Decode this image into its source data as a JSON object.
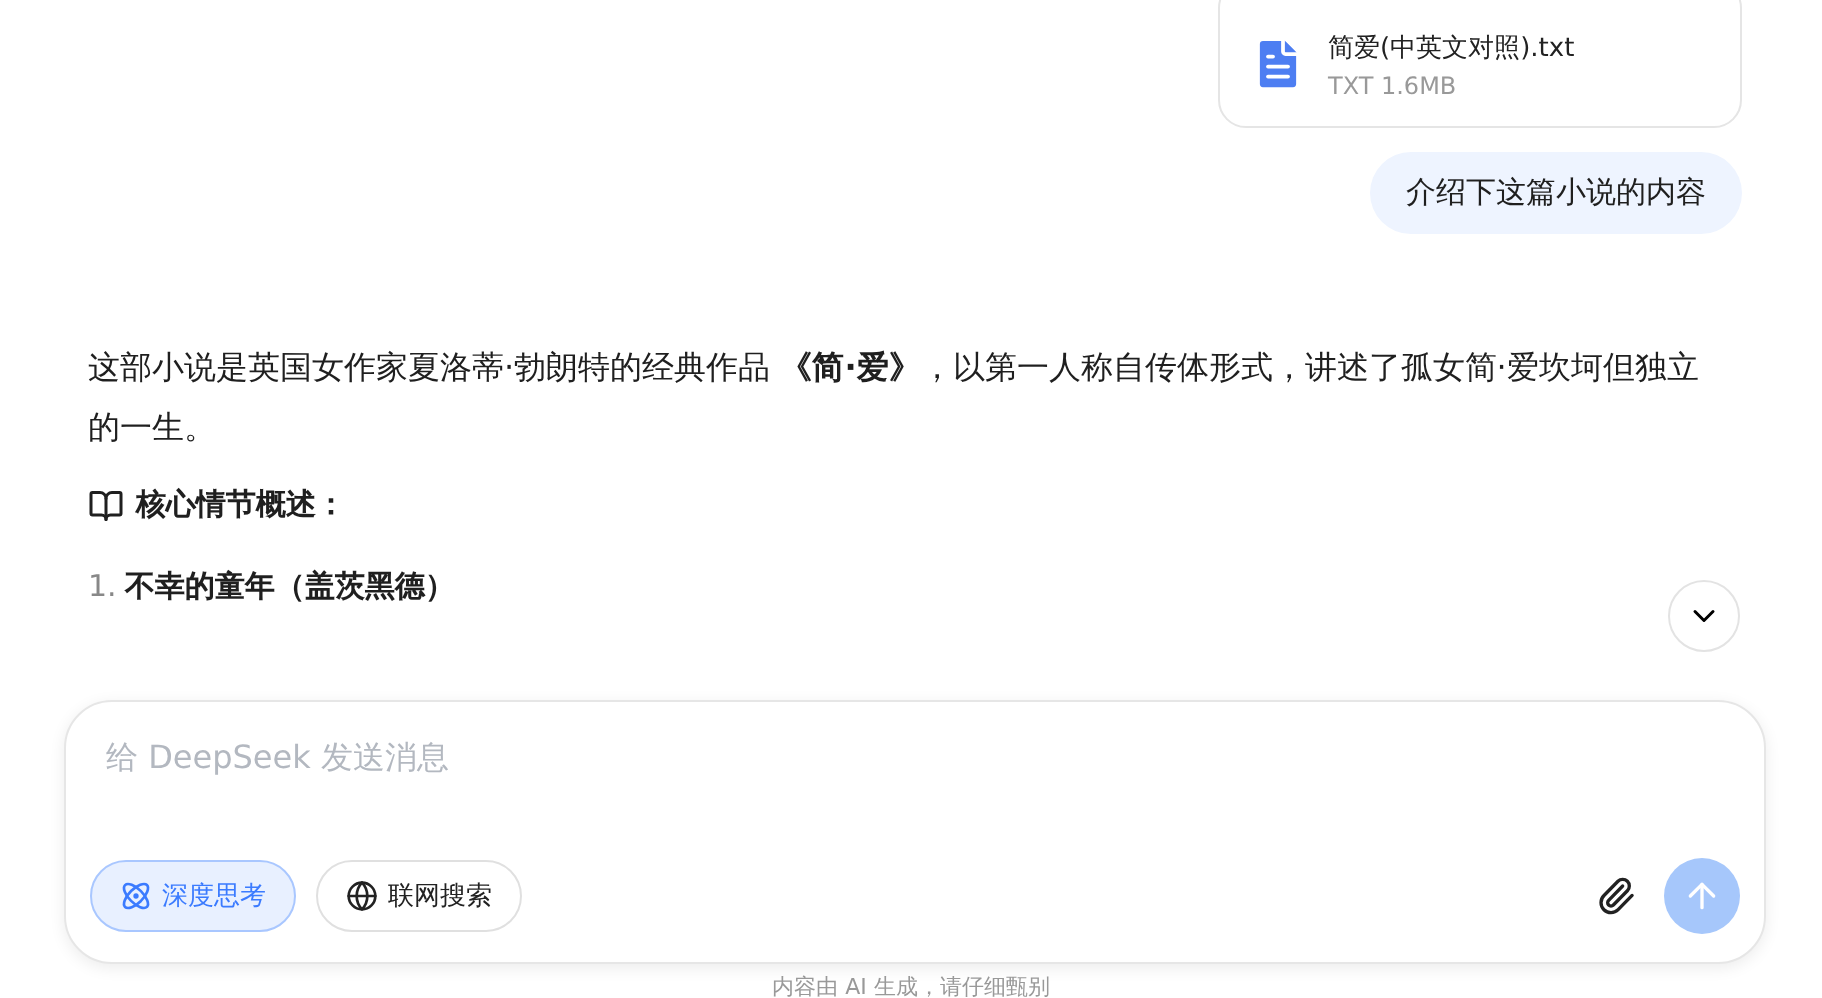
{
  "attachment": {
    "name": "简爱(中英文对照).txt",
    "meta": "TXT 1.6MB"
  },
  "user_message": "介绍下这篇小说的内容",
  "answer": {
    "intro_parts": [
      "这部小说是英国女作家夏洛蒂·勃朗特的经典作品",
      "《简·爱》",
      "，以第一人称自传体形式，讲述了孤女简·爱坎坷但独立的一生。"
    ],
    "heading": "核心情节概述：",
    "list": [
      {
        "number": "1.",
        "title": "不幸的童年（盖茨黑德）"
      }
    ]
  },
  "composer": {
    "placeholder": "给 DeepSeek 发送消息",
    "toggles": [
      {
        "label": "深度思考",
        "kind": "think",
        "selected": true
      },
      {
        "label": "联网搜索",
        "kind": "web",
        "selected": false
      }
    ]
  },
  "disclaimer": "内容由 AI 生成，请仔细甄别"
}
